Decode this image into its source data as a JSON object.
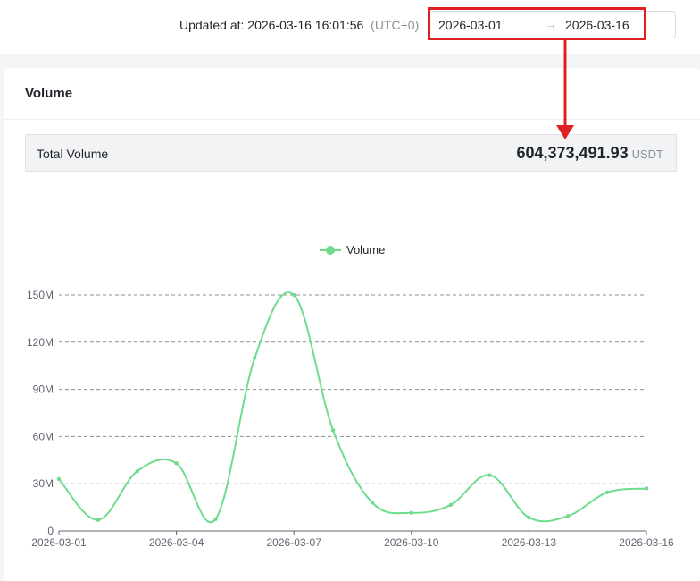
{
  "header": {
    "updated_label": "Updated at:",
    "updated_value": "2026-03-16 16:01:56",
    "timezone": "(UTC+0)",
    "range_start": "2026-03-01",
    "range_arrow": "→",
    "range_end": "2026-03-16"
  },
  "card": {
    "title": "Volume",
    "total_label": "Total Volume",
    "total_value": "604,373,491.93",
    "total_unit": "USDT"
  },
  "colors": {
    "line": "#6fdc8c",
    "highlight": "#e02020"
  },
  "chart_data": {
    "type": "line",
    "title": "",
    "xlabel": "",
    "ylabel": "",
    "legend": [
      "Volume"
    ],
    "legend_position": "top-center",
    "grid": true,
    "ylim": [
      0,
      150000000
    ],
    "yticks": [
      "0",
      "30M",
      "60M",
      "90M",
      "120M",
      "150M"
    ],
    "xticks": [
      "2026-03-01",
      "2026-03-04",
      "2026-03-07",
      "2026-03-10",
      "2026-03-13",
      "2026-03-16"
    ],
    "x": [
      "2026-03-01",
      "2026-03-02",
      "2026-03-03",
      "2026-03-04",
      "2026-03-05",
      "2026-03-06",
      "2026-03-07",
      "2026-03-08",
      "2026-03-09",
      "2026-03-10",
      "2026-03-11",
      "2026-03-12",
      "2026-03-13",
      "2026-03-14",
      "2026-03-15",
      "2026-03-16"
    ],
    "series": [
      {
        "name": "Volume",
        "values": [
          33000000,
          7000000,
          38000000,
          43000000,
          7500000,
          110000000,
          150000000,
          64000000,
          18000000,
          11500000,
          16500000,
          35500000,
          8500000,
          9500000,
          24500000,
          27000000
        ]
      }
    ]
  }
}
